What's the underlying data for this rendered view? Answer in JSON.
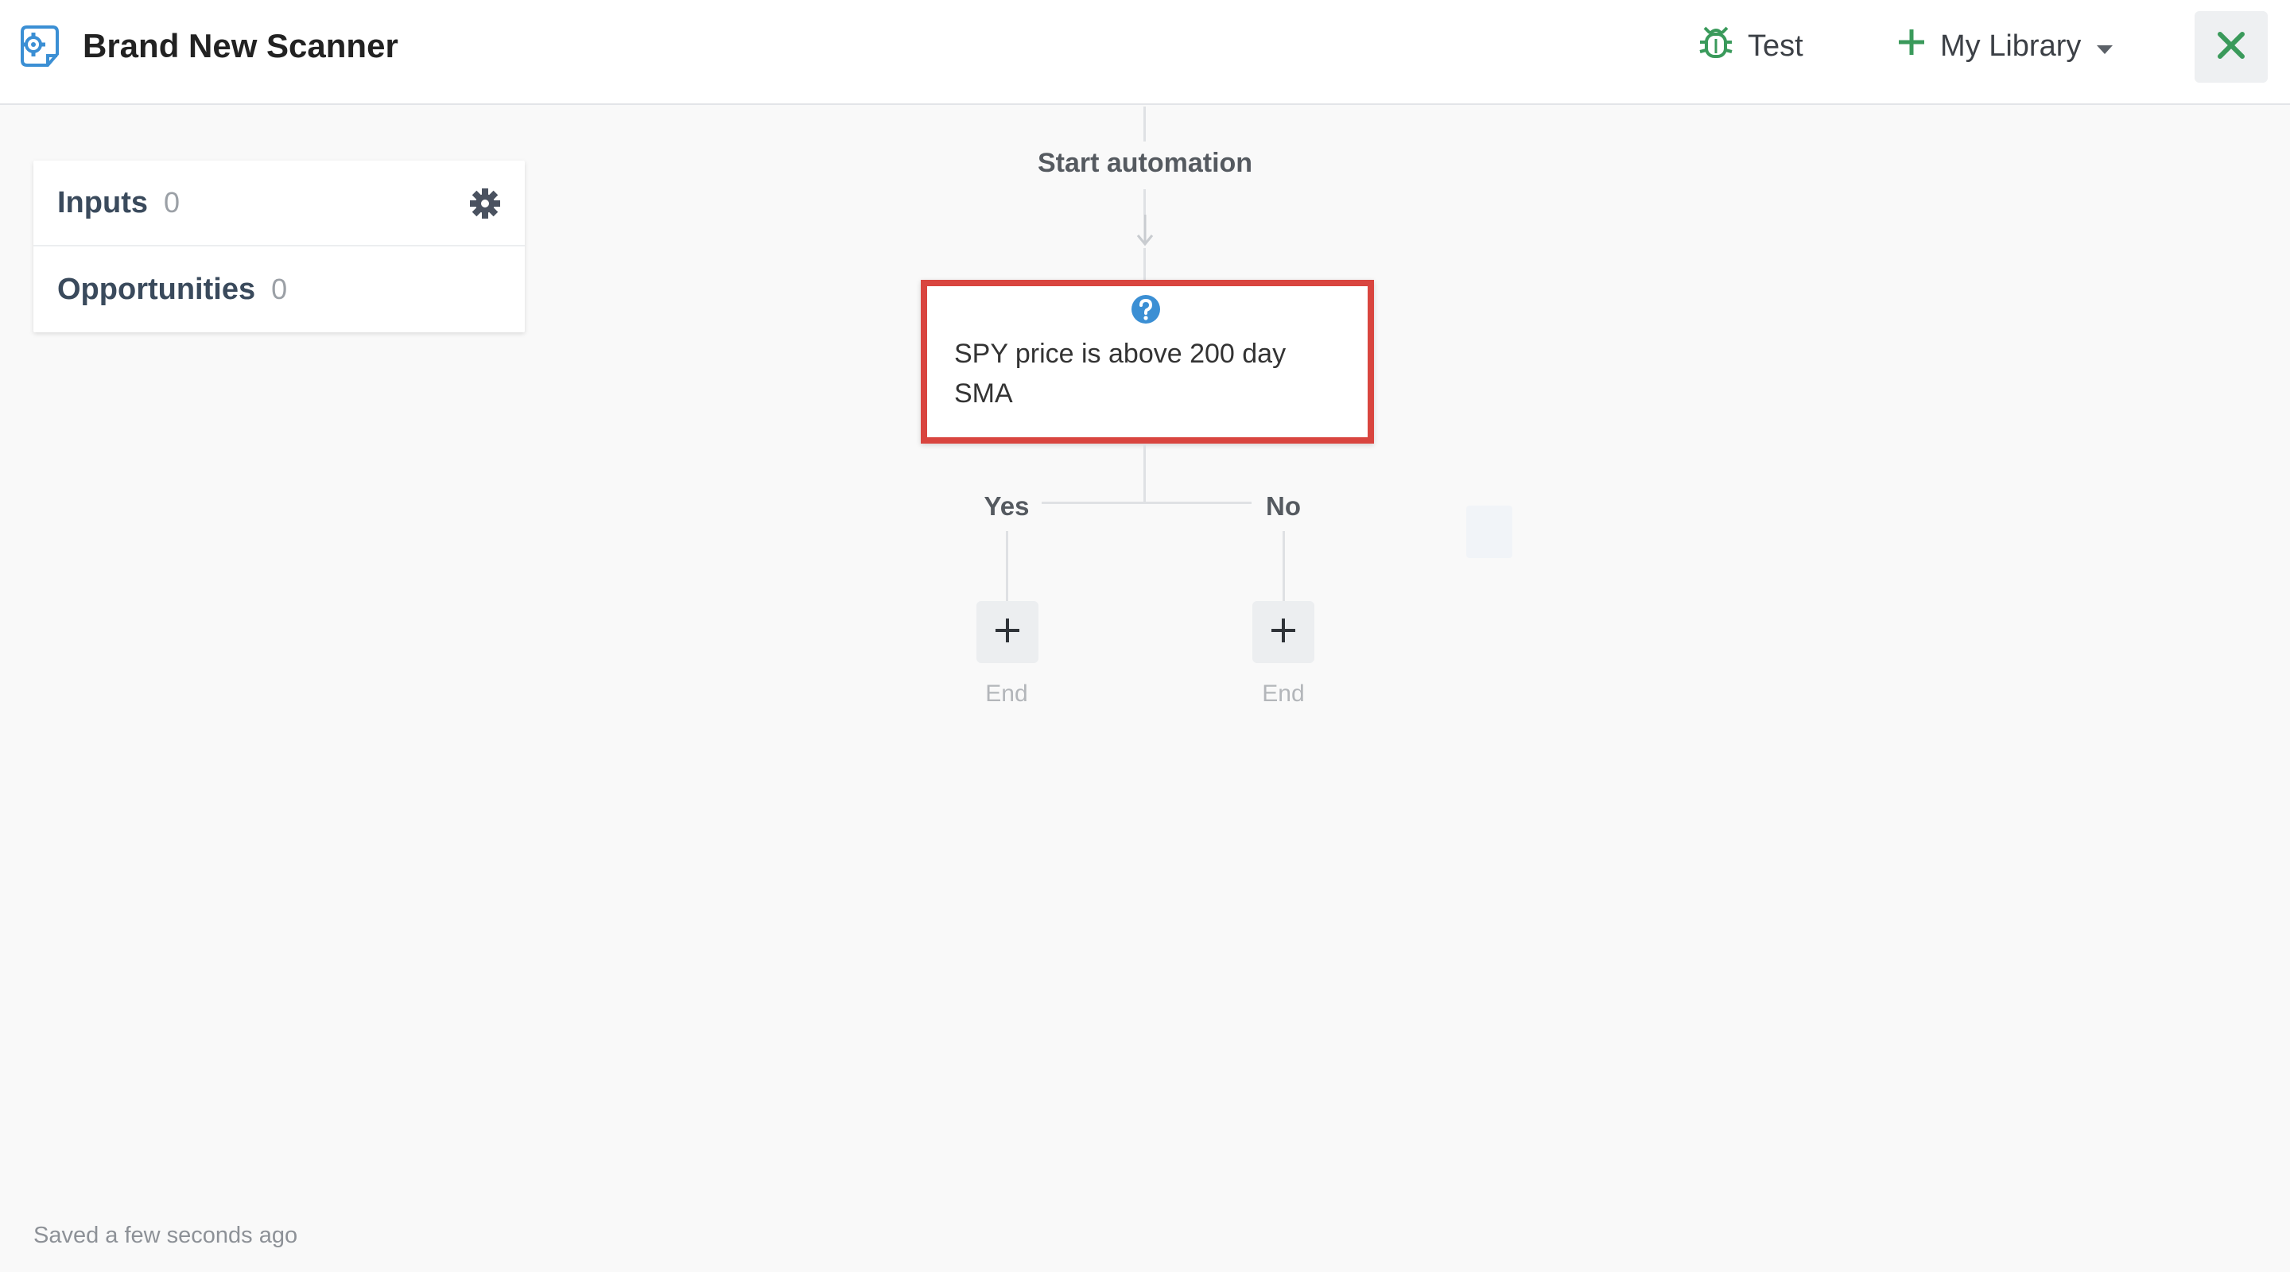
{
  "header": {
    "title": "Brand New Scanner",
    "app_icon": "scanner-gear-icon",
    "test_label": "Test",
    "test_icon": "bug-icon",
    "library_label": "My Library",
    "library_icon": "plus-icon",
    "close_icon": "close-icon"
  },
  "panel": {
    "inputs_label": "Inputs",
    "inputs_count": "0",
    "opportunities_label": "Opportunities",
    "opportunities_count": "0",
    "settings_icon": "gear-icon"
  },
  "flow": {
    "start_label": "Start automation",
    "condition_text": "SPY price is above 200 day SMA",
    "help_icon": "question-icon",
    "yes_label": "Yes",
    "no_label": "No",
    "yes_end_label": "End",
    "no_end_label": "End"
  },
  "status": {
    "saved_text": "Saved a few seconds ago"
  },
  "colors": {
    "accent_green": "#3a9a5b",
    "brand_blue": "#3b8fd4",
    "highlight_red": "#d9453f"
  }
}
